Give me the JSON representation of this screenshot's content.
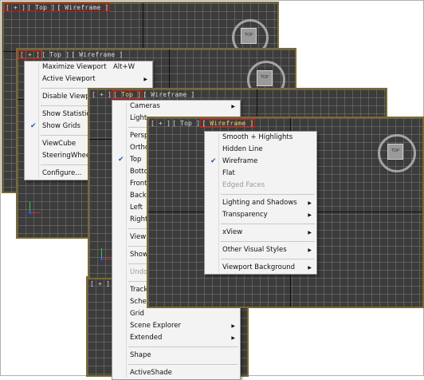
{
  "viewport_labels": {
    "plus": "[ + ]",
    "view": "[ Top ]",
    "shading": "[ Wireframe ]",
    "partial_left": "[ + ] [ Le"
  },
  "viewcube": {
    "face": "TOP"
  },
  "menu1": {
    "items": [
      {
        "label": "Maximize Viewport",
        "shortcut": "Alt+W"
      },
      {
        "label": "Active Viewport",
        "arrow": "▶"
      },
      {
        "label": "Disable Viewp"
      },
      {
        "label": "Show Statistics"
      },
      {
        "label": "Show Grids",
        "checked": "✔"
      },
      {
        "label": "ViewCube"
      },
      {
        "label": "SteeringWheel"
      },
      {
        "label": "Configure..."
      }
    ]
  },
  "menu2": {
    "items": [
      {
        "label": "Cameras",
        "arrow": "▶"
      },
      {
        "label": "Light"
      },
      {
        "label": "Persp"
      },
      {
        "label": "Ortho"
      },
      {
        "label": "Top",
        "checked": "✔"
      },
      {
        "label": "Botto"
      },
      {
        "label": "Front"
      },
      {
        "label": "Back"
      },
      {
        "label": "Left"
      },
      {
        "label": "Right"
      },
      {
        "label": "View"
      },
      {
        "label": "Show"
      },
      {
        "label": "Undo"
      },
      {
        "label": "Track"
      },
      {
        "label": "Sche"
      },
      {
        "label": "Grid"
      },
      {
        "label": "Scene Explorer",
        "arrow": "▶"
      },
      {
        "label": "Extended",
        "arrow": "▶"
      },
      {
        "label": "Shape"
      },
      {
        "label": "ActiveShade"
      }
    ]
  },
  "menu3": {
    "items": [
      {
        "label": "Smooth + Highlights"
      },
      {
        "label": "Hidden Line"
      },
      {
        "label": "Wireframe",
        "checked": "✔"
      },
      {
        "label": "Flat"
      },
      {
        "label": "Edged Faces"
      },
      {
        "label": "Lighting and Shadows",
        "arrow": "▶"
      },
      {
        "label": "Transparency",
        "arrow": "▶"
      },
      {
        "label": "xView",
        "arrow": "▶"
      },
      {
        "label": "Other Visual Styles",
        "arrow": "▶"
      },
      {
        "label": "Viewport Background",
        "arrow": "▶"
      }
    ]
  }
}
